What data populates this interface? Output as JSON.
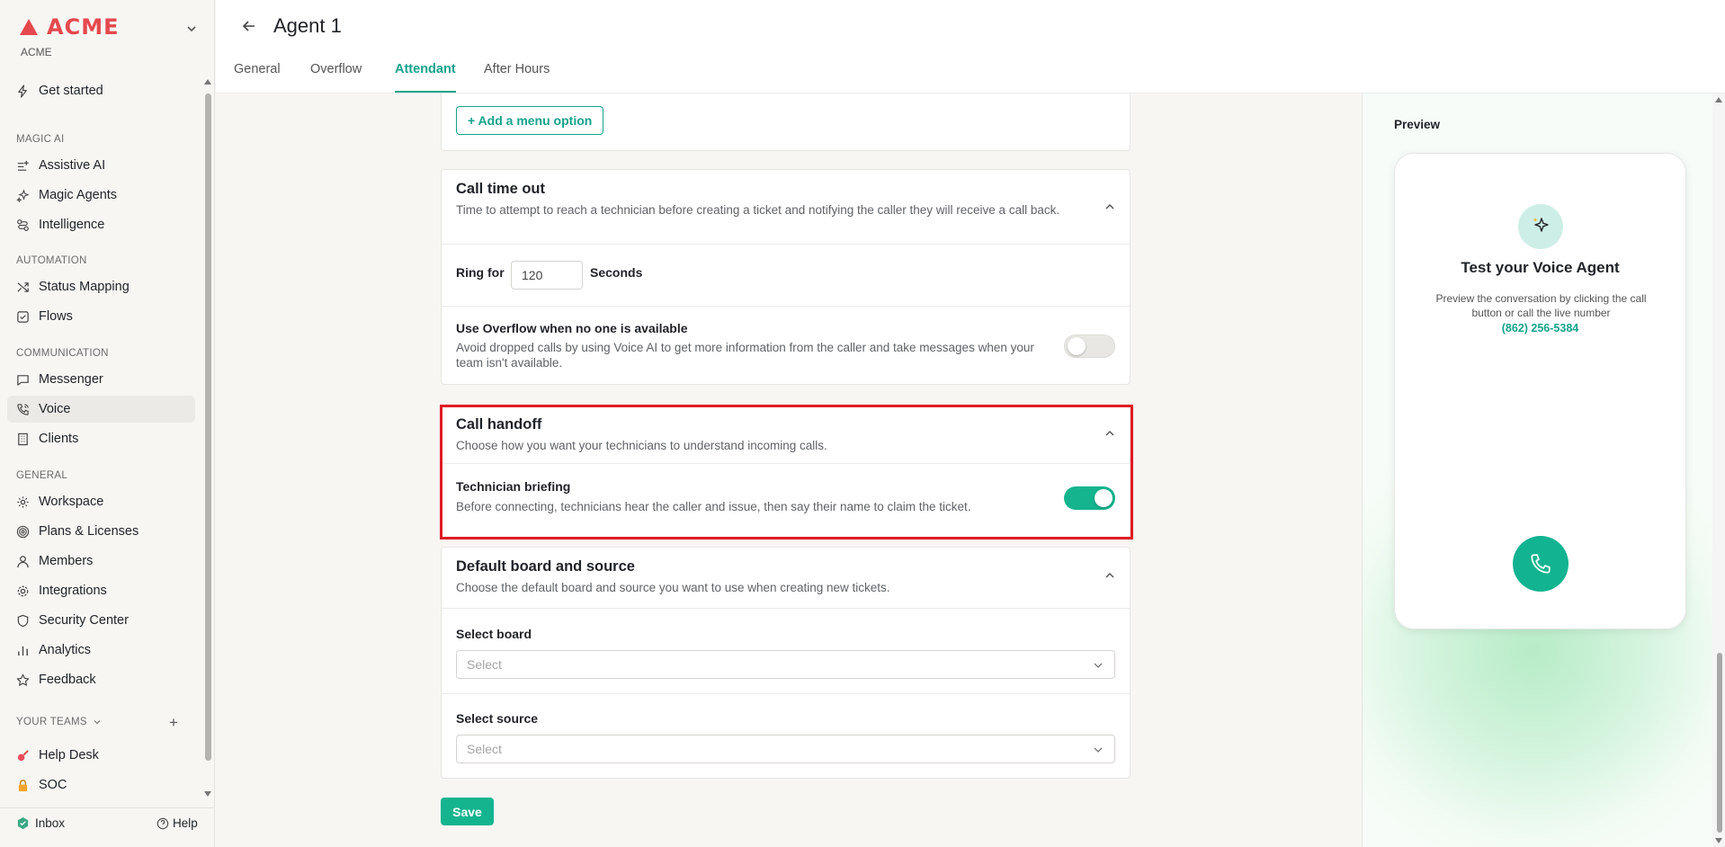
{
  "brand": {
    "logo_text": "ACME",
    "subtitle": "ACME"
  },
  "sidebar": {
    "get_started": "Get started",
    "sections": {
      "magic_ai": "MAGIC AI",
      "automation": "AUTOMATION",
      "communication": "COMMUNICATION",
      "general": "GENERAL",
      "your_teams": "YOUR TEAMS"
    },
    "items": {
      "assistive_ai": "Assistive AI",
      "magic_agents": "Magic Agents",
      "intelligence": "Intelligence",
      "status_mapping": "Status Mapping",
      "flows": "Flows",
      "messenger": "Messenger",
      "voice": "Voice",
      "clients": "Clients",
      "workspace": "Workspace",
      "plans_licenses": "Plans & Licenses",
      "members": "Members",
      "integrations": "Integrations",
      "security_center": "Security Center",
      "analytics": "Analytics",
      "feedback": "Feedback",
      "help_desk": "Help Desk",
      "soc": "SOC"
    },
    "add_team_symbol": "+",
    "footer": {
      "inbox": "Inbox",
      "help": "Help"
    }
  },
  "header": {
    "title": "Agent 1",
    "tabs": [
      "General",
      "Overflow",
      "Attendant",
      "After Hours"
    ],
    "active_tab": "Attendant"
  },
  "main": {
    "add_menu_option": "+ Add a menu option",
    "call_timeout": {
      "title": "Call time out",
      "description": "Time to attempt to reach a technician before creating a ticket and notifying the caller they will receive a call back.",
      "ring_for_label": "Ring for",
      "ring_for_value": "120",
      "seconds_label": "Seconds",
      "overflow_title": "Use Overflow when no one is available",
      "overflow_desc": "Avoid dropped calls by using Voice AI to get more information from the caller and take messages when your team isn't available.",
      "overflow_enabled": false
    },
    "call_handoff": {
      "title": "Call handoff",
      "description": "Choose how you want your technicians to understand incoming calls.",
      "briefing_title": "Technician briefing",
      "briefing_desc": "Before connecting, technicians hear the caller and issue, then say their name to claim the ticket.",
      "briefing_enabled": true
    },
    "default_board": {
      "title": "Default board and source",
      "description": "Choose the default board and source you want to use when creating new tickets.",
      "board_label": "Select board",
      "board_placeholder": "Select",
      "source_label": "Select source",
      "source_placeholder": "Select"
    },
    "save_label": "Save"
  },
  "preview": {
    "label": "Preview",
    "title": "Test your Voice Agent",
    "description": "Preview the conversation by clicking the call button or call the live number",
    "phone_number": "(862) 256-5384"
  },
  "colors": {
    "accent": "#14a38b",
    "toggle_on": "#14b48f",
    "brand_red": "#e5484d",
    "highlight": "#e01b24"
  }
}
